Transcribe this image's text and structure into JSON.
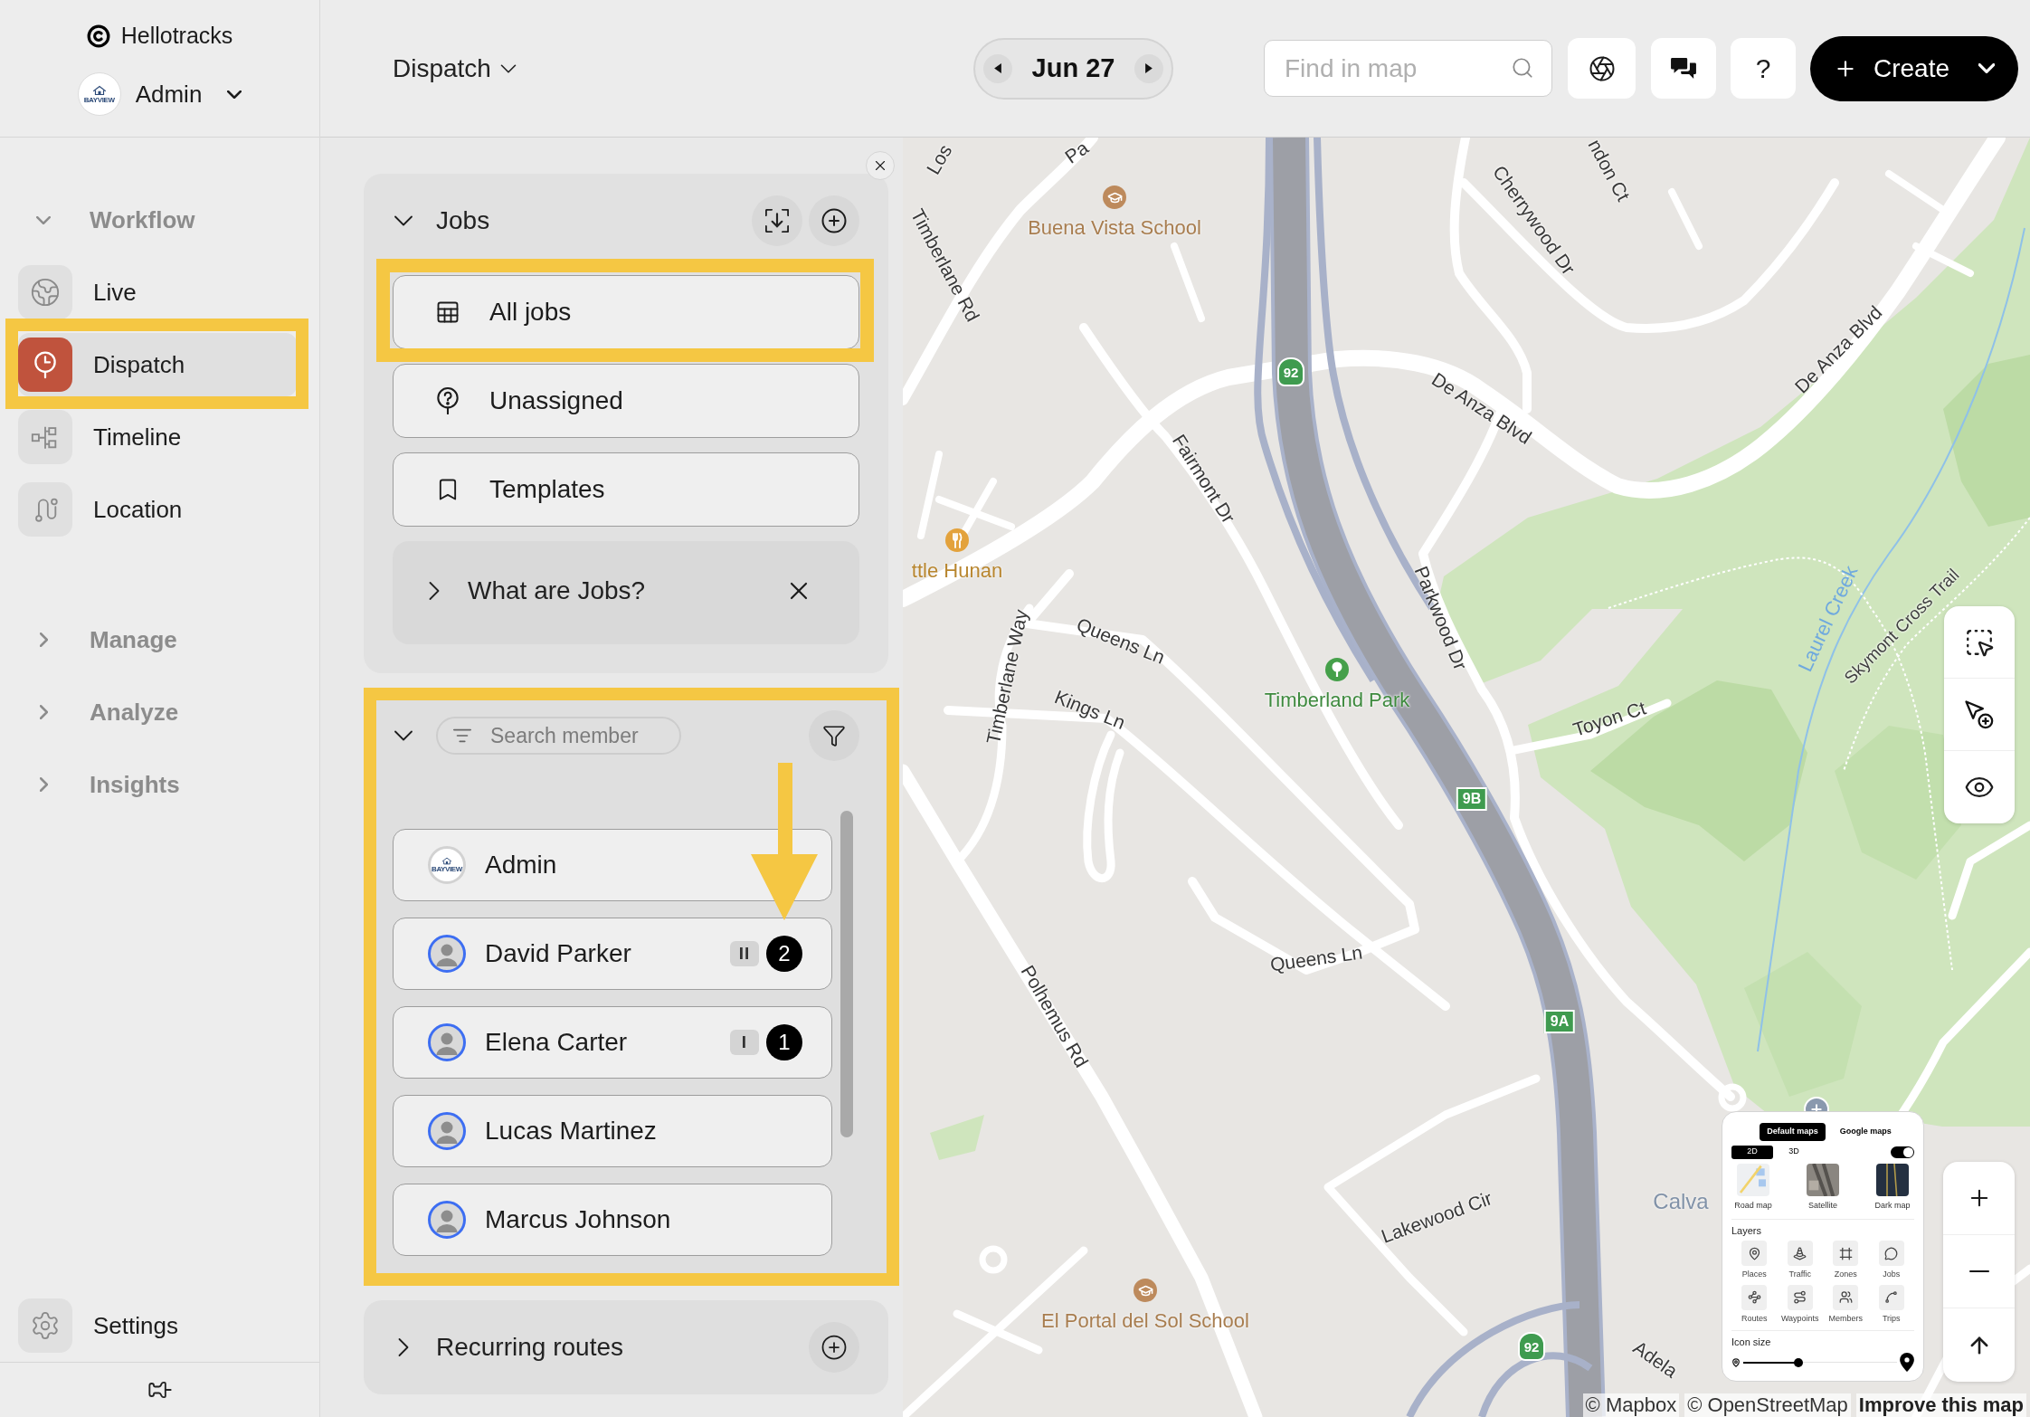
{
  "sidebar": {
    "brand": "Hellotracks",
    "account": {
      "name": "Admin",
      "logo_text": "BAYVIEW"
    },
    "groups": [
      {
        "label": "Workflow",
        "expanded": true,
        "items": [
          {
            "label": "Live",
            "selected": false,
            "highlighted": false
          },
          {
            "label": "Dispatch",
            "selected": true,
            "highlighted": true
          },
          {
            "label": "Timeline",
            "selected": false,
            "highlighted": false
          },
          {
            "label": "Location",
            "selected": false,
            "highlighted": false
          }
        ]
      },
      {
        "label": "Manage",
        "expanded": false
      },
      {
        "label": "Analyze",
        "expanded": false
      },
      {
        "label": "Insights",
        "expanded": false
      }
    ],
    "settings": "Settings"
  },
  "header": {
    "view_menu": "Dispatch",
    "date": "Jun 27",
    "search": {
      "placeholder": "Find in map"
    },
    "help_button": "?",
    "create_button": "Create"
  },
  "jobs_panel": {
    "title": "Jobs",
    "expanded": true,
    "items": [
      {
        "label": "All jobs",
        "highlighted": true
      },
      {
        "label": "Unassigned",
        "highlighted": false
      },
      {
        "label": "Templates",
        "highlighted": false
      }
    ],
    "help": {
      "label": "What are Jobs?",
      "expanded": false
    }
  },
  "members_panel": {
    "expanded": true,
    "highlighted": true,
    "search": {
      "placeholder": "Search member"
    },
    "members": [
      {
        "name": "Admin",
        "kind": "company",
        "logo_text": "BAYVIEW"
      },
      {
        "name": "David Parker",
        "kind": "person",
        "tag": "II",
        "count": "2"
      },
      {
        "name": "Elena Carter",
        "kind": "person",
        "tag": "I",
        "count": "1"
      },
      {
        "name": "Lucas Martinez",
        "kind": "person"
      },
      {
        "name": "Marcus Johnson",
        "kind": "person"
      }
    ]
  },
  "recurring_routes": {
    "title": "Recurring routes",
    "expanded": false
  },
  "map": {
    "labels": [
      {
        "text": "Los",
        "kind": "street"
      },
      {
        "text": "Pa",
        "kind": "street"
      },
      {
        "text": "Buena Vista School",
        "kind": "school"
      },
      {
        "text": "Timberlane Rd",
        "kind": "street"
      },
      {
        "text": "Cherrywood Dr",
        "kind": "street"
      },
      {
        "text": "ndon Ct",
        "kind": "street"
      },
      {
        "text": "De Anza Blvd",
        "kind": "street"
      },
      {
        "text": "De Anza Blvd",
        "kind": "street"
      },
      {
        "text": "Fairmont Dr",
        "kind": "street"
      },
      {
        "text": "ttle Hunan",
        "kind": "restaurant"
      },
      {
        "text": "Timberlane Way",
        "kind": "street"
      },
      {
        "text": "Queens Ln",
        "kind": "street"
      },
      {
        "text": "Kings Ln",
        "kind": "street"
      },
      {
        "text": "Timberland Park",
        "kind": "park"
      },
      {
        "text": "Parkwood Dr",
        "kind": "street"
      },
      {
        "text": "Toyon Ct",
        "kind": "street"
      },
      {
        "text": "Laurel Creek",
        "kind": "water"
      },
      {
        "text": "Skymont Cross Trail",
        "kind": "trail"
      },
      {
        "text": "Queens Ln",
        "kind": "street"
      },
      {
        "text": "Polhemus Rd",
        "kind": "street"
      },
      {
        "text": "Lakewood Cir",
        "kind": "street"
      },
      {
        "text": "El Portal del Sol School",
        "kind": "school"
      },
      {
        "text": "Calva",
        "kind": "town"
      },
      {
        "text": "Adela",
        "kind": "street"
      },
      {
        "text": "92",
        "kind": "route-shield"
      },
      {
        "text": "9B",
        "kind": "exit-shield"
      },
      {
        "text": "9A",
        "kind": "exit-shield"
      },
      {
        "text": "92",
        "kind": "route-shield"
      }
    ],
    "style_panel": {
      "sources": [
        {
          "label": "Default maps",
          "selected": true
        },
        {
          "label": "Google maps",
          "selected": false
        }
      ],
      "modes": [
        {
          "label": "2D",
          "selected": true
        },
        {
          "label": "3D",
          "selected": false
        }
      ],
      "toggle": {
        "on": true
      },
      "styles": [
        {
          "label": "Road map"
        },
        {
          "label": "Satellite"
        },
        {
          "label": "Dark map"
        }
      ],
      "layers_title": "Layers",
      "layers": [
        {
          "label": "Places"
        },
        {
          "label": "Traffic"
        },
        {
          "label": "Zones"
        },
        {
          "label": "Jobs"
        },
        {
          "label": "Routes"
        },
        {
          "label": "Waypoints"
        },
        {
          "label": "Members"
        },
        {
          "label": "Trips"
        }
      ],
      "icon_size": {
        "label": "Icon size",
        "level": 0.36
      }
    },
    "attribution": [
      {
        "label": "© Mapbox",
        "kind": "credit"
      },
      {
        "label": "© OpenStreetMap",
        "kind": "credit"
      },
      {
        "label": "Improve this map",
        "kind": "feedback"
      }
    ]
  }
}
